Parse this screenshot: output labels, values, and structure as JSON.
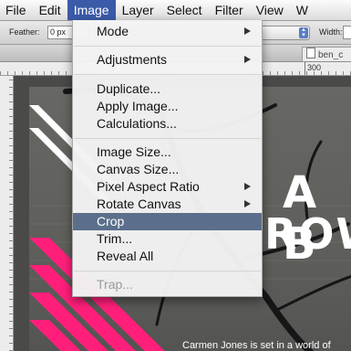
{
  "menubar": {
    "items": [
      "File",
      "Edit",
      "Image",
      "Layer",
      "Select",
      "Filter",
      "View",
      "W"
    ],
    "active": "Image"
  },
  "options_bar": {
    "feather_label": "Feather:",
    "feather_value": "0 px",
    "width_label": "Width:"
  },
  "document": {
    "tab_label": "ben_c",
    "ruler_mark": "300"
  },
  "canvas": {
    "headline_1": "A B",
    "headline_2": "ROW",
    "caption": "Carmen Jones is set in a world of"
  },
  "image_menu": {
    "items": [
      {
        "label": "Mode",
        "submenu": true
      },
      {
        "label": "Adjustments",
        "submenu": true
      },
      {
        "label": "Duplicate..."
      },
      {
        "label": "Apply Image..."
      },
      {
        "label": "Calculations..."
      },
      {
        "label": "Image Size..."
      },
      {
        "label": "Canvas Size..."
      },
      {
        "label": "Pixel Aspect Ratio",
        "submenu": true
      },
      {
        "label": "Rotate Canvas",
        "submenu": true
      },
      {
        "label": "Crop",
        "highlighted": true
      },
      {
        "label": "Trim..."
      },
      {
        "label": "Reveal All"
      },
      {
        "label": "Trap...",
        "disabled": true
      }
    ]
  },
  "colors": {
    "menu_highlight": "#5b6f8c",
    "menubar_active": "#3b5aa7",
    "accent_pink": "#ff1f7a"
  }
}
